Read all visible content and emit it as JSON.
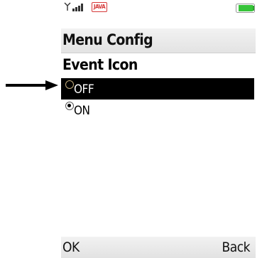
{
  "status_bar": {
    "signal_icon": "signal-strength-icon",
    "java_label": "JAVA",
    "battery_icon": "battery-icon",
    "battery_color": "#37c43a"
  },
  "header": {
    "title": "Menu Config"
  },
  "main": {
    "subtitle": "Event Icon",
    "options": [
      {
        "label": "OFF",
        "selected": true,
        "checked": false
      },
      {
        "label": "ON",
        "selected": false,
        "checked": true
      }
    ]
  },
  "softkeys": {
    "left": "OK",
    "right": "Back"
  },
  "annotation": {
    "icon": "right-arrow-icon"
  }
}
